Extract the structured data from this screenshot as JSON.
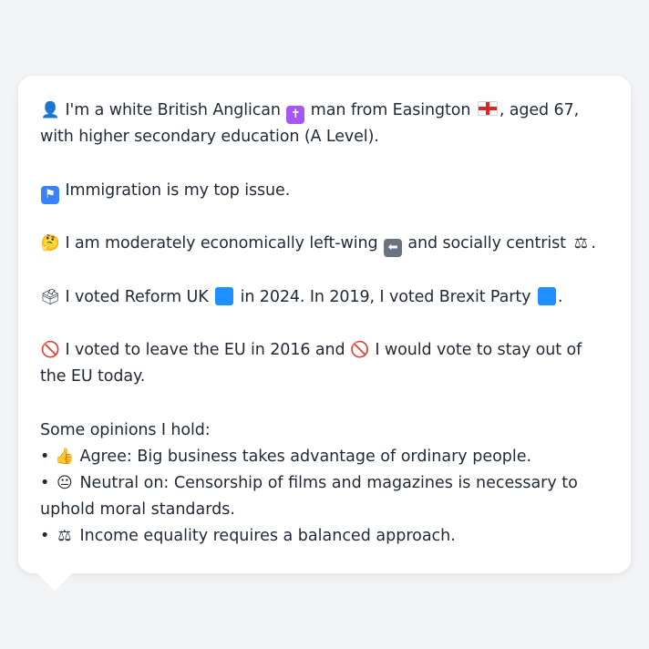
{
  "colors": {
    "background": "#f3f4f6",
    "bubble": "#ffffff",
    "text": "#1f2937",
    "cross_box": "#a855f7",
    "transport_box": "#3b82f6",
    "left_arrow_box": "#6b7280",
    "reform_uk": "#1e90ff",
    "brexit_party": "#1e90ff"
  },
  "icons": {
    "person": "person-silhouette-icon",
    "religion": "latin-cross-icon",
    "location_flag": "flag-england-icon",
    "top_issue": "passport-control-icon",
    "thinking": "thinking-face-icon",
    "left_wing": "left-arrow-icon",
    "centrist": "balance-scale-icon",
    "ballot": "ballot-box-icon",
    "party_2024": "blue-square-icon",
    "party_2019": "blue-square-icon",
    "eu_2016": "prohibited-icon",
    "eu_today": "prohibited-icon",
    "agree": "thumbs-up-icon",
    "neutral": "neutral-face-icon",
    "balanced": "balance-scale-icon"
  },
  "profile": {
    "intro_a": " I'm a white British Anglican ",
    "intro_b": " man from Easington ",
    "intro_c": ", aged 67, with higher secondary education (A Level).",
    "issue": " Immigration is my top issue.",
    "stance_a": " I am moderately economically left-wing ",
    "stance_b": " and socially centrist ",
    "stance_c": ".",
    "vote_a": " I voted Reform UK ",
    "vote_b": " in 2024. In 2019, I voted Brexit Party ",
    "vote_c": ".",
    "eu_a": " I voted to leave the EU in 2016 and ",
    "eu_b": " I would vote to stay out of the EU today.",
    "opinions_heading": "Some opinions I hold:",
    "opinion_1": " Agree: Big business takes advantage of ordinary people.",
    "opinion_2": " Neutral on: Censorship of films and magazines is necessary to uphold moral standards.",
    "opinion_3": " Income equality requires a balanced approach.",
    "bullet": "•"
  }
}
